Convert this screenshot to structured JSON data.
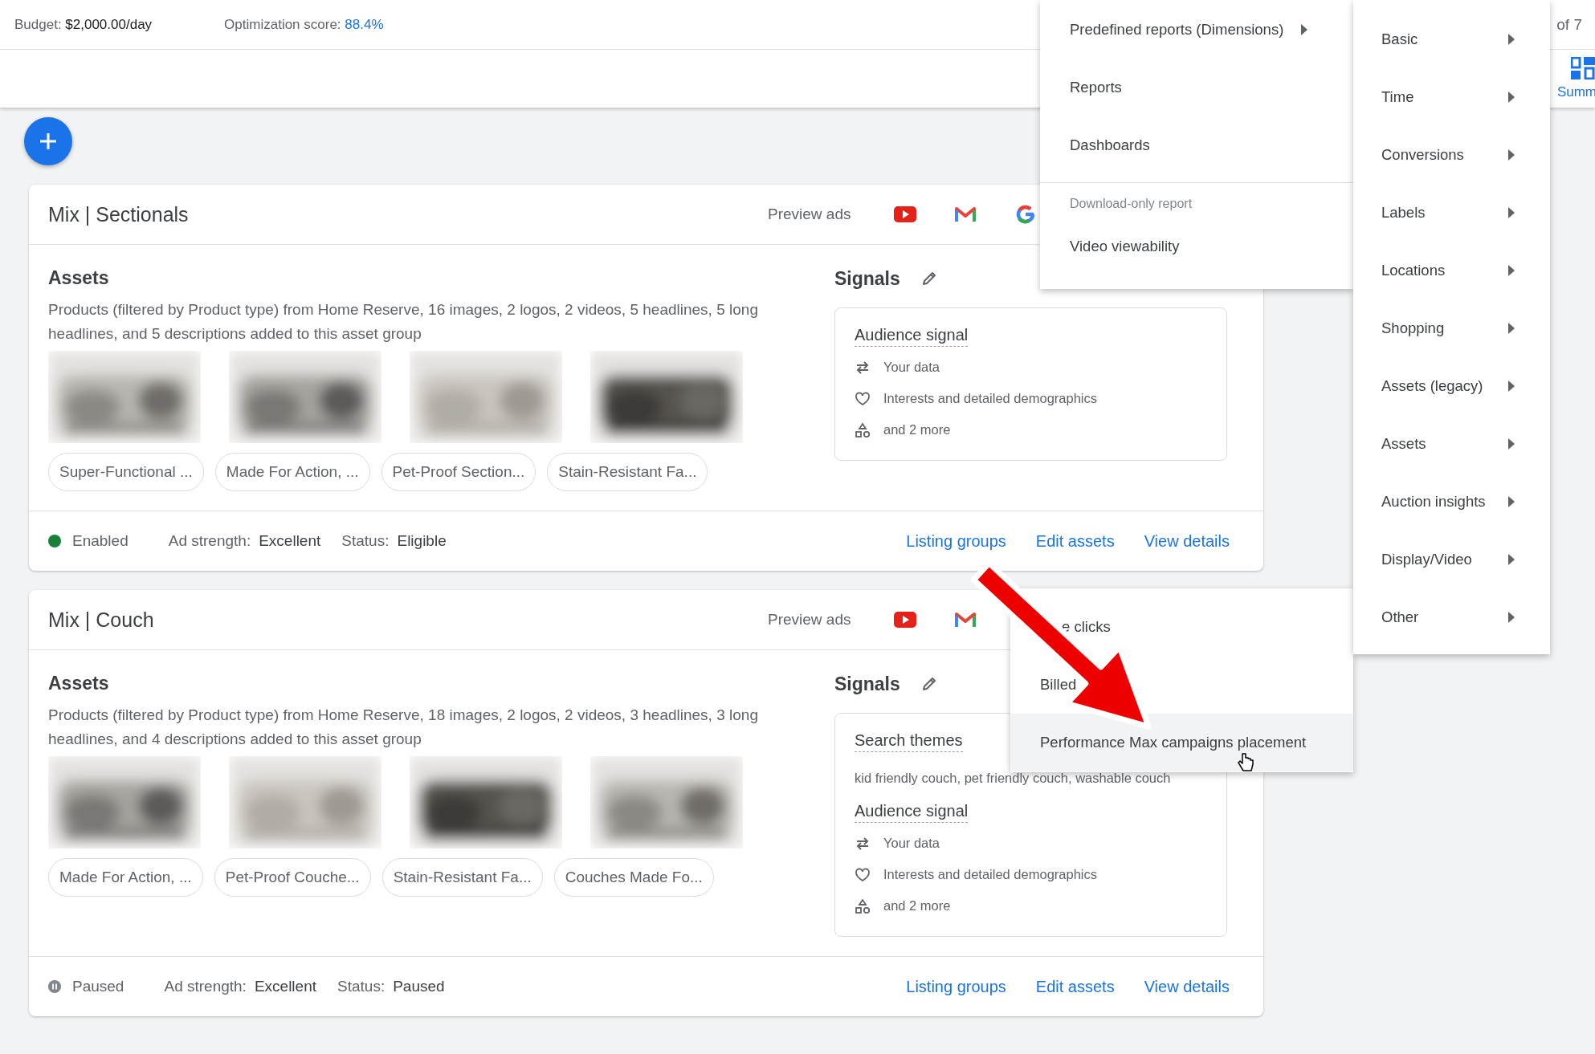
{
  "top_bar": {
    "budget_label": "Budget:",
    "budget_value": "$2,000.00/day",
    "optimization_label": "Optimization score:",
    "optimization_value": "88.4%",
    "page_count": "of 7"
  },
  "summary_button": {
    "label": "Summ"
  },
  "asset_groups": [
    {
      "title": "Mix | Sectionals",
      "preview_label": "Preview ads",
      "assets_title": "Assets",
      "assets_description": "Products (filtered by Product type) from Home Reserve, 16 images, 2 logos, 2 videos, 5 headlines, 5 long headlines, and 5 descriptions added to this asset group",
      "images": [
        {
          "kind": "picture"
        },
        {
          "kind": "picture"
        },
        {
          "kind": "picture"
        },
        {
          "kind": "picture"
        }
      ],
      "headlines": [
        "Super-Functional ...",
        "Made For Action, ...",
        "Pet-Proof Section...",
        "Stain-Resistant Fa..."
      ],
      "signals_title": "Signals",
      "signals": [
        {
          "kind": "audience",
          "title": "Audience signal",
          "items": [
            {
              "kind": "data",
              "text": "Your data"
            },
            {
              "kind": "interests",
              "text": "Interests and detailed demographics"
            },
            {
              "kind": "more",
              "text": "and 2 more"
            }
          ]
        }
      ],
      "enabled": true,
      "status_label": "Enabled",
      "ad_strength_label": "Ad strength:",
      "ad_strength": "Excellent",
      "status_field_label": "Status:",
      "status_value": "Eligible",
      "links": [
        "Listing groups",
        "Edit assets",
        "View details"
      ]
    },
    {
      "title": "Mix | Couch",
      "preview_label": "Preview ads",
      "assets_title": "Assets",
      "assets_description": "Products (filtered by Product type) from Home Reserve, 18 images, 2 logos, 2 videos, 3 headlines, 3 long headlines, and 4 descriptions added to this asset group",
      "images": [
        {
          "kind": "picture"
        },
        {
          "kind": "picture"
        },
        {
          "kind": "picture"
        },
        {
          "kind": "picture"
        }
      ],
      "headlines": [
        "Made For Action, ...",
        "Pet-Proof Couche...",
        "Stain-Resistant Fa...",
        "Couches Made Fo..."
      ],
      "signals_title": "Signals",
      "signals": [
        {
          "kind": "themes",
          "title": "Search themes",
          "text": "kid friendly couch, pet friendly couch, washable couch"
        },
        {
          "kind": "audience",
          "title": "Audience signal",
          "items": [
            {
              "kind": "data",
              "text": "Your data"
            },
            {
              "kind": "interests",
              "text": "Interests and detailed demographics"
            },
            {
              "kind": "more",
              "text": "and 2 more"
            }
          ]
        }
      ],
      "enabled": false,
      "status_label": "Paused",
      "ad_strength_label": "Ad strength:",
      "ad_strength": "Excellent",
      "status_field_label": "Status:",
      "status_value": "Paused",
      "links": [
        "Listing groups",
        "Edit assets",
        "View details"
      ]
    }
  ],
  "reports_menu": {
    "items": [
      {
        "kind": "item",
        "label": "Predefined reports (Dimensions)",
        "has_submenu": true
      },
      {
        "kind": "item",
        "label": "Reports",
        "has_submenu": false
      },
      {
        "kind": "item",
        "label": "Dashboards",
        "has_submenu": false
      },
      {
        "kind": "header",
        "label": "Download-only report"
      },
      {
        "kind": "item",
        "label": "Video viewability",
        "has_submenu": false
      }
    ]
  },
  "dimensions_menu": {
    "items": [
      {
        "label": "Basic",
        "has_submenu": true
      },
      {
        "label": "Time",
        "has_submenu": true
      },
      {
        "label": "Conversions",
        "has_submenu": true
      },
      {
        "label": "Labels",
        "has_submenu": true
      },
      {
        "label": "Locations",
        "has_submenu": true
      },
      {
        "label": "Shopping",
        "has_submenu": true
      },
      {
        "label": "Assets (legacy)",
        "has_submenu": true
      },
      {
        "label": "Assets",
        "has_submenu": true
      },
      {
        "label": "Auction insights",
        "has_submenu": true
      },
      {
        "label": "Display/Video",
        "has_submenu": true
      },
      {
        "label": "Other",
        "has_submenu": true
      }
    ]
  },
  "other_menu": {
    "items": [
      {
        "label": "e clicks",
        "selected": false
      },
      {
        "label": "Billed",
        "selected": false
      },
      {
        "label": "Performance Max campaigns placement",
        "selected": true
      }
    ]
  }
}
